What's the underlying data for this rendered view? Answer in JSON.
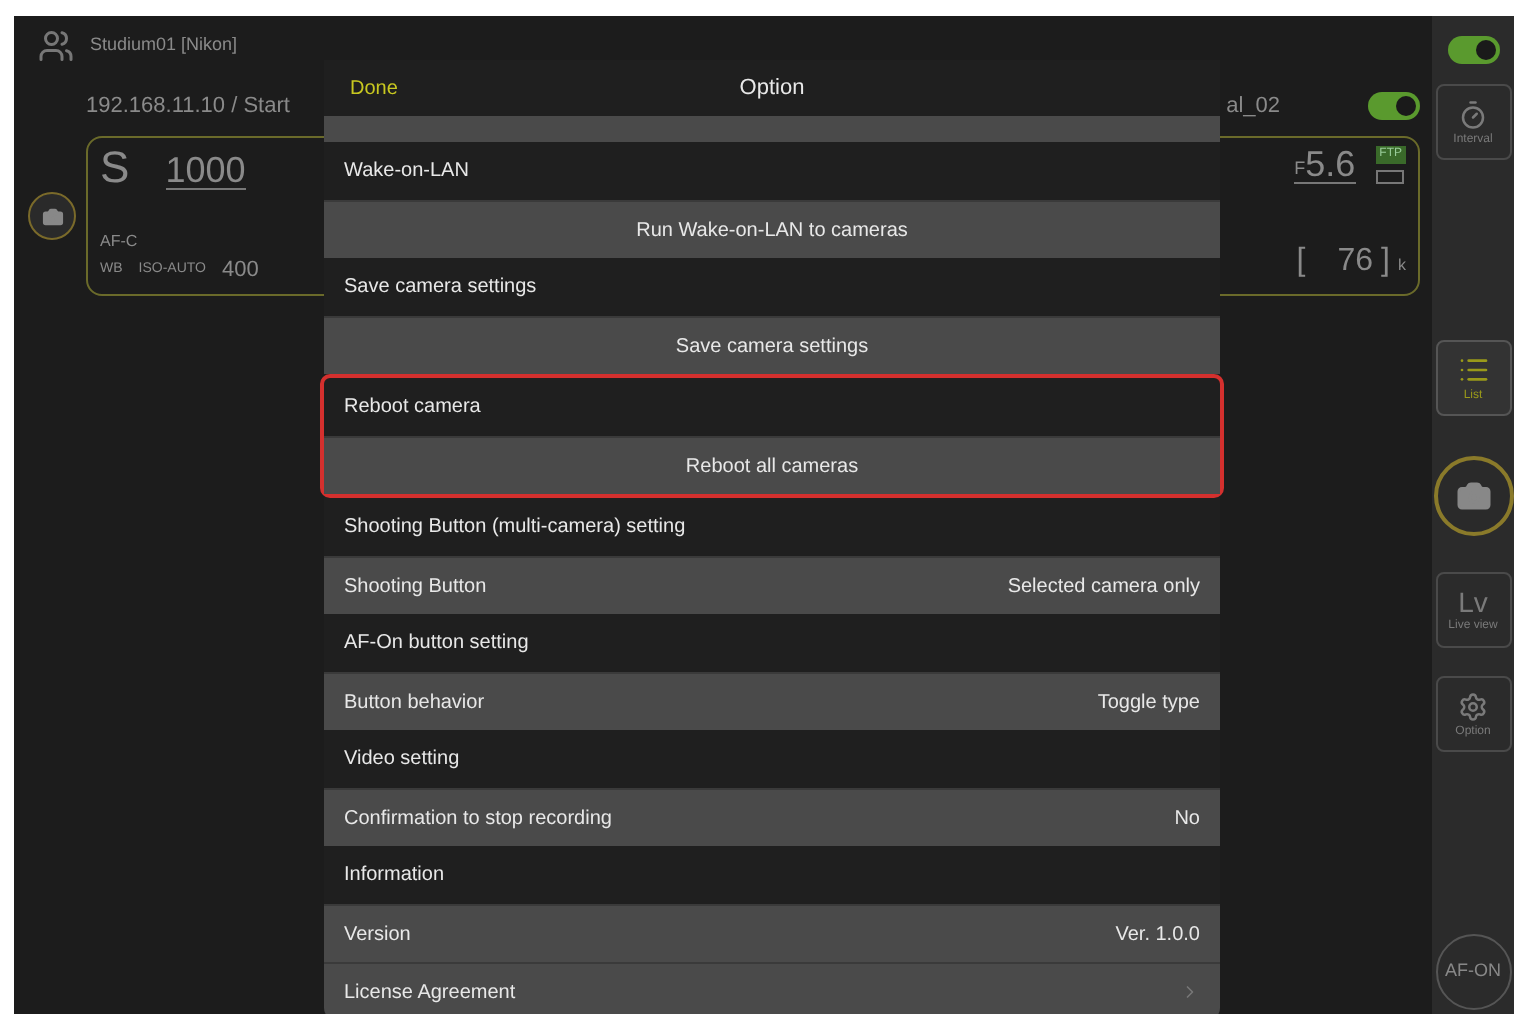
{
  "app": {
    "group_name": "Studium01 [Nikon]",
    "address": "192.168.11.10 / Start"
  },
  "camera_left": {
    "mode": "S",
    "shutter": "1000",
    "focus_mode": "AF-C",
    "wb": "WB",
    "iso_label": "ISO-AUTO",
    "iso": "400"
  },
  "camera_right": {
    "name": "al_02",
    "on": true,
    "aperture_prefix": "F",
    "aperture": "5.6",
    "badge": "FTP",
    "count_open": "[",
    "count": "76",
    "count_close": "]",
    "count_unit": "k"
  },
  "sidebar": {
    "switch": {
      "on": true
    },
    "items": [
      {
        "kind": "timer",
        "label": "Interval",
        "selected": false
      },
      {
        "kind": "list",
        "label": "List",
        "selected": true
      },
      {
        "kind": "shutter"
      },
      {
        "kind": "lettered",
        "big": "Lv",
        "label": "Live view",
        "selected": false
      },
      {
        "kind": "gear",
        "label": "Option",
        "selected": false
      },
      {
        "kind": "round",
        "label": "AF-ON"
      }
    ]
  },
  "modal": {
    "done": "Done",
    "title": "Option",
    "sections": [
      {
        "header": "Wake-on-LAN",
        "highlighted": false,
        "rows": [
          {
            "kind": "action",
            "label": "Run Wake-on-LAN to cameras"
          }
        ]
      },
      {
        "header": "Save camera settings",
        "highlighted": false,
        "rows": [
          {
            "kind": "action",
            "label": "Save camera settings"
          }
        ]
      },
      {
        "header": "Reboot camera",
        "highlighted": true,
        "rows": [
          {
            "kind": "action",
            "label": "Reboot all cameras"
          }
        ]
      },
      {
        "header": "Shooting Button (multi-camera) setting",
        "highlighted": false,
        "rows": [
          {
            "kind": "value",
            "label": "Shooting Button",
            "value": "Selected camera only"
          }
        ]
      },
      {
        "header": "AF-On button setting",
        "highlighted": false,
        "rows": [
          {
            "kind": "value",
            "label": "Button behavior",
            "value": "Toggle type"
          }
        ]
      },
      {
        "header": "Video setting",
        "highlighted": false,
        "rows": [
          {
            "kind": "value",
            "label": "Confirmation to stop recording",
            "value": "No"
          }
        ]
      },
      {
        "header": "Information",
        "highlighted": false,
        "rows": [
          {
            "kind": "value",
            "label": "Version",
            "value": "Ver. 1.0.0"
          },
          {
            "kind": "link",
            "label": "License Agreement"
          }
        ]
      }
    ]
  }
}
